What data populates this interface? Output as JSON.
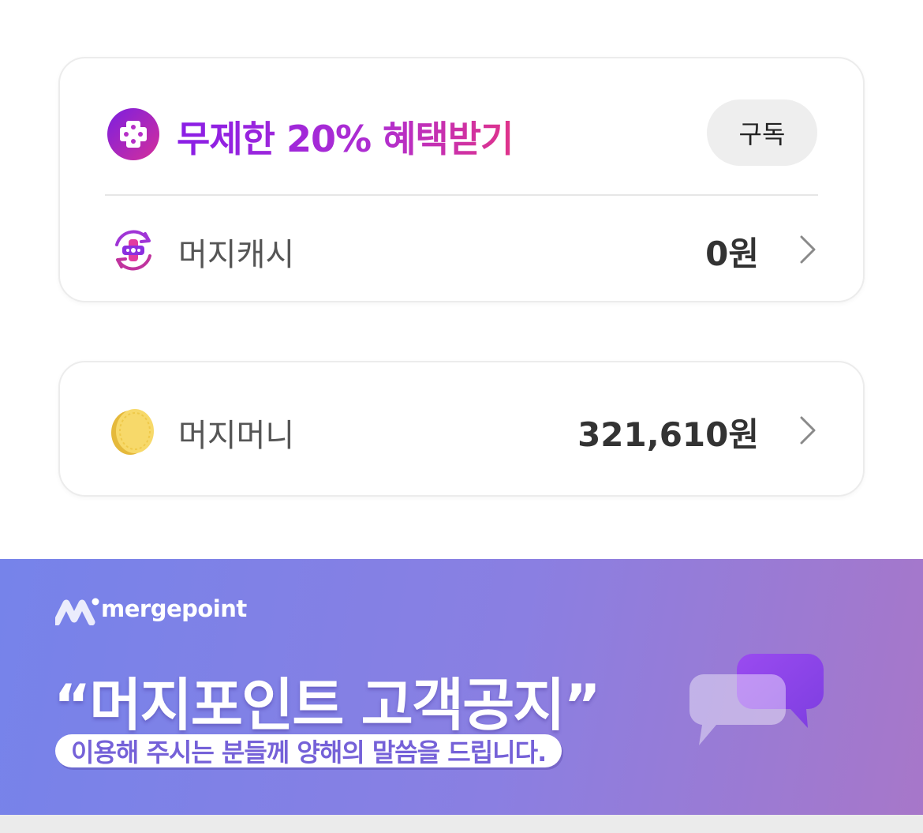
{
  "promo": {
    "title": "무제한 20% 혜택받기",
    "subscribe_label": "구독"
  },
  "cash": {
    "label": "머지캐시",
    "value": "0원"
  },
  "money": {
    "label": "머지머니",
    "value": "321,610원"
  },
  "banner": {
    "brand": "mergepoint",
    "title": "“머지포인트 고객공지”",
    "subtitle": "이용해 주시는 분들께 양해의 말씀을 드립니다."
  },
  "colors": {
    "promo_gradient_start": "#8a1ee6",
    "promo_gradient_end": "#e0338a",
    "banner_gradient_start": "#7683ea",
    "banner_gradient_end": "#a777c9"
  },
  "icons": {
    "promo": "merge-plus-icon",
    "cash": "cash-refresh-icon",
    "money": "coin-icon",
    "chevron": "chevron-right-icon",
    "brand": "mergepoint-logo",
    "bubbles": "chat-bubbles-icon"
  }
}
